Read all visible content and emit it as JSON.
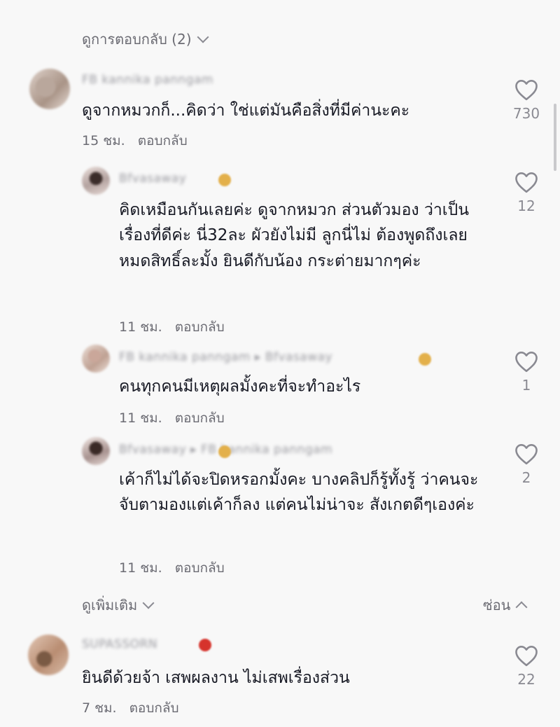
{
  "view_replies_label": "ดูการตอบกลับ (2)",
  "comments": [
    {
      "username": "FB kannika panngam",
      "text": "ดูจากหมวกก็...คิดว่า ใช่แต่มันคือสิ่งที่มีค่านะคะ",
      "time": "15 ชม.",
      "reply_label": "ตอบกลับ",
      "likes": "730"
    },
    {
      "username": "Bfvasaway",
      "text": "คิดเหมือนกันเลยค่ะ ดูจากหมวก ส่วนตัวมอง ว่าเป็นเรื่องที่ดีค่ะ นี่32ละ ผัวยังไม่มี ลูกนี่ไม่ ต้องพูดถึงเลย หมดสิทธิ์ละมั้ง ยินดีกับน้อง กระต่ายมากๆค่ะ",
      "time": "11 ชม.",
      "reply_label": "ตอบกลับ",
      "likes": "12"
    },
    {
      "username": "FB kannika panngam ▸ Bfvasaway",
      "text": "คนทุกคนมีเหตุผลมั้งคะที่จะทำอะไร",
      "time": "11 ชม.",
      "reply_label": "ตอบกลับ",
      "likes": "1"
    },
    {
      "username": "Bfvasaway ▸ FB kannika panngam",
      "text": "เค้าก็ไม่ได้จะปิดหรอกมั้งคะ บางคลิปก็รู้ทั้งรู้ ว่าคนจะจับตามองแต่เค้าก็ลง แต่คนไม่น่าจะ สังเกตดีๆเองค่ะ",
      "time": "11 ชม.",
      "reply_label": "ตอบกลับ",
      "likes": "2"
    },
    {
      "username": "SUPASSORN",
      "text": "ยินดีด้วยจ้า เสพผลงาน ไม่เสพเรื่องส่วน",
      "time": "7 ชม.",
      "reply_label": "ตอบกลับ",
      "likes": "22"
    }
  ],
  "view_more_label": "ดูเพิ่มเติม",
  "hide_label": "ซ่อน",
  "icons": [
    "heart-icon",
    "chevron-down-icon",
    "chevron-up-icon"
  ],
  "colors": {
    "text": "#161823",
    "muted": "#6b6b73",
    "background": "#f8f8f8"
  }
}
